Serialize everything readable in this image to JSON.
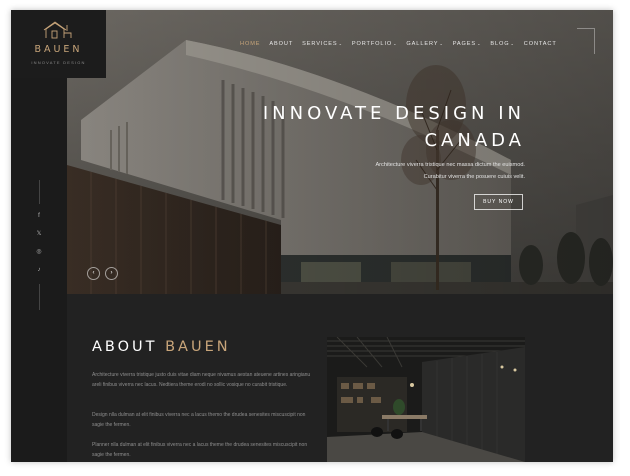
{
  "brand": {
    "name": "BAUEN",
    "tagline": "INNOVATE DESIGN"
  },
  "nav": {
    "items": [
      {
        "label": "HOME",
        "active": true
      },
      {
        "label": "ABOUT"
      },
      {
        "label": "SERVICES",
        "dropdown": true
      },
      {
        "label": "PORTFOLIO",
        "dropdown": true
      },
      {
        "label": "GALLERY",
        "dropdown": true
      },
      {
        "label": "PAGES",
        "dropdown": true
      },
      {
        "label": "BLOG",
        "dropdown": true
      },
      {
        "label": "CONTACT"
      }
    ]
  },
  "hero": {
    "title_line1": "INNOVATE DESIGN IN",
    "title_line2": "CANADA",
    "subtitle_line1": "Architecture viverra tristique nec massa dictum the euismod.",
    "subtitle_line2": "Curabitur viverra the posuere cuiuis velit.",
    "button_label": "BUY NOW"
  },
  "social": [
    "f",
    "𝕏",
    "◎",
    "♪"
  ],
  "slider": {
    "prev": "‹",
    "next": "›"
  },
  "about": {
    "title_prefix": "ABOUT",
    "title_accent": "BAUEN",
    "paragraphs": [
      "Architecture viverra tristique justo duis vitae diam neque nivamus aestan ateuene artines aringianu areli finibus viverra nec lacus. Nedtiera theme erodi no sollic vosique no curabit tristique.",
      "Design nlla dulman at elit finibus viverra nec a lacus themo the drudea senesites miscuscipit non sagie the fermen.",
      "Planner nlla dulman at elit finibus viverra nec a lacus theme the drudea senesites miscuscipit non sagie the fermen."
    ]
  },
  "colors": {
    "accent": "#c8a57a",
    "background": "#222222",
    "rail": "#1b1b1b"
  }
}
